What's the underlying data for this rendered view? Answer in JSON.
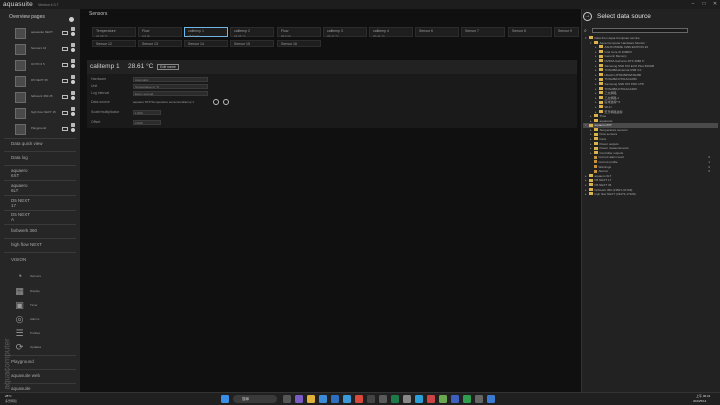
{
  "app": {
    "logo": "aquasuite",
    "version": "Version 4.0.7"
  },
  "sidebar": {
    "overview_heading": "Overview pages",
    "pages": [
      {
        "label": "aquasuite NEXT"
      },
      {
        "label": "Sensors 16"
      },
      {
        "label": "OCTO 6 5"
      },
      {
        "label": "D5 NEXT 65"
      },
      {
        "label": "farbwerk 360 25"
      },
      {
        "label": "high flow NEXT 15"
      },
      {
        "label": "Playground"
      }
    ],
    "sections": [
      "Data quick view",
      "Data log",
      "aquaero\n6XT",
      "aquaero\n6LT",
      "D5 NEXT\n17",
      "D5 NEXT\nA",
      "farbwerk 360",
      "high flow NEXT"
    ],
    "vision_heading": "VISION",
    "vision_items": [
      "Sensors",
      "Display",
      "Timer",
      "Alarms",
      "Profiles",
      "Updates"
    ],
    "bottom_sections": [
      "Playground",
      "aquasuite web",
      "aquasuite"
    ],
    "vertical_logo": "aquacomputer"
  },
  "main": {
    "title": "Sensors",
    "tiles": [
      {
        "name": "Temperature",
        "value": "22.39 °C"
      },
      {
        "name": "Flow",
        "value": "0.0 l/h"
      },
      {
        "name": "calitemp 1",
        "value": "28.61 °C",
        "selected": true
      },
      {
        "name": "calitemp 2",
        "value": "22.66 °C"
      },
      {
        "name": "Flow",
        "value": "99.0 l/h"
      },
      {
        "name": "calitemp 3",
        "value": "20.47 °C"
      },
      {
        "name": "calitemp 4",
        "value": "20.41 °C"
      },
      {
        "name": "Sensor 6",
        "value": ""
      },
      {
        "name": "Sensor 7",
        "value": ""
      },
      {
        "name": "Sensor 8",
        "value": ""
      },
      {
        "name": "Sensor 9",
        "value": ""
      }
    ],
    "tiles_row2": [
      "Sensor 12",
      "Sensor 13",
      "Sensor 14",
      "Sensor 15",
      "Sensor 16"
    ],
    "detail": {
      "name": "calitemp 1",
      "value": "28.61 °C",
      "edit_label": "Edit name",
      "fields": [
        {
          "label": "Hardware",
          "value": "Automatic"
        },
        {
          "label": "Unit",
          "value": "Temperature in °C"
        },
        {
          "label": "Log interval",
          "value": "Every second"
        },
        {
          "label": "Data source",
          "value": "aquaero 6XT/Temperature sensors/calitemp 1"
        },
        {
          "label": "Scale/multiplicator",
          "value": "1.000"
        },
        {
          "label": "Offset",
          "value": "0.000"
        }
      ]
    }
  },
  "right_panel": {
    "title": "Select data source",
    "tree": [
      {
        "depth": 0,
        "arrow": "▾",
        "label": "Data from Aqua Computer service"
      },
      {
        "depth": 1,
        "arrow": "▾",
        "label": "Aqua Computer Hardware Monitor"
      },
      {
        "depth": 2,
        "arrow": "▸",
        "label": "ASUS PRIME X299 EDITION 30"
      },
      {
        "depth": 2,
        "arrow": "▸",
        "label": "Intel Core i9 10980X"
      },
      {
        "depth": 2,
        "arrow": "▸",
        "label": "Generic Memory"
      },
      {
        "depth": 2,
        "arrow": "▸",
        "label": "NVIDIA GeForce RTX 2080 Ti"
      },
      {
        "depth": 2,
        "arrow": "▸",
        "label": "Samsung SSD 970 EVO Plus 500GB"
      },
      {
        "depth": 2,
        "arrow": "▸",
        "label": "TOSHIBA External USB 3.0"
      },
      {
        "depth": 2,
        "arrow": "▸",
        "label": "Hitachi HTS545050A7E380"
      },
      {
        "depth": 2,
        "arrow": "▸",
        "label": "TOSHIBA DT01ACA050"
      },
      {
        "depth": 2,
        "arrow": "▸",
        "label": "Samsung SSD 970 PRO 1TB"
      },
      {
        "depth": 2,
        "arrow": "▸",
        "label": "TOSHIBA DT01ACA300"
      },
      {
        "depth": 2,
        "arrow": "▸",
        "label": "乙太網路"
      },
      {
        "depth": 2,
        "arrow": "▸",
        "label": "乙太網路 2"
      },
      {
        "depth": 2,
        "arrow": "▸",
        "label": "區域連線* 8"
      },
      {
        "depth": 2,
        "arrow": "▸",
        "label": "Wi-Fi"
      },
      {
        "depth": 2,
        "arrow": "▸",
        "label": "藍牙網路連線"
      },
      {
        "depth": 1,
        "arrow": "▸",
        "label": "Time"
      },
      {
        "depth": 1,
        "arrow": "▸",
        "label": "aquasuite"
      },
      {
        "depth": 0,
        "arrow": "▾",
        "label": "aquaero 6XT",
        "highlight": true
      },
      {
        "depth": 1,
        "arrow": "▸",
        "label": "Temperature sensors"
      },
      {
        "depth": 1,
        "arrow": "▸",
        "label": "Flow sensors"
      },
      {
        "depth": 1,
        "arrow": "▸",
        "label": "Fans"
      },
      {
        "depth": 1,
        "arrow": "▸",
        "label": "Power outputs"
      },
      {
        "depth": 1,
        "arrow": "▸",
        "label": "Power measurements"
      },
      {
        "depth": 1,
        "arrow": "▸",
        "label": "Controller outputs"
      },
      {
        "depth": 1,
        "arrow": "",
        "label": "Current alarm level",
        "right": "0",
        "leaf": true
      },
      {
        "depth": 1,
        "arrow": "",
        "label": "Current profile",
        "right": "1",
        "leaf": true
      },
      {
        "depth": 1,
        "arrow": "",
        "label": "Warnings",
        "right": "0",
        "leaf": true
      },
      {
        "depth": 1,
        "arrow": "",
        "label": "Alarms",
        "right": "0",
        "leaf": true
      },
      {
        "depth": 0,
        "arrow": "▸",
        "label": "aquaero 6LT"
      },
      {
        "depth": 0,
        "arrow": "▸",
        "label": "D5 NEXT 17"
      },
      {
        "depth": 0,
        "arrow": "▸",
        "label": "D5 NEXT 36"
      },
      {
        "depth": 0,
        "arrow": "▸",
        "label": "farbwerk 360 (13507-31709)"
      },
      {
        "depth": 0,
        "arrow": "▸",
        "label": "high flow NEXT (33473-17328)"
      }
    ]
  },
  "taskbar": {
    "weather_temp": "28°C",
    "weather_desc": "多雲時陰",
    "search_label": "搜尋",
    "time": "上午 06:24",
    "date": "2023/5/14"
  },
  "colors": {
    "accent": "#6fb6e6",
    "folder": "#d9b24a",
    "highlight": "#4a4a4a"
  }
}
